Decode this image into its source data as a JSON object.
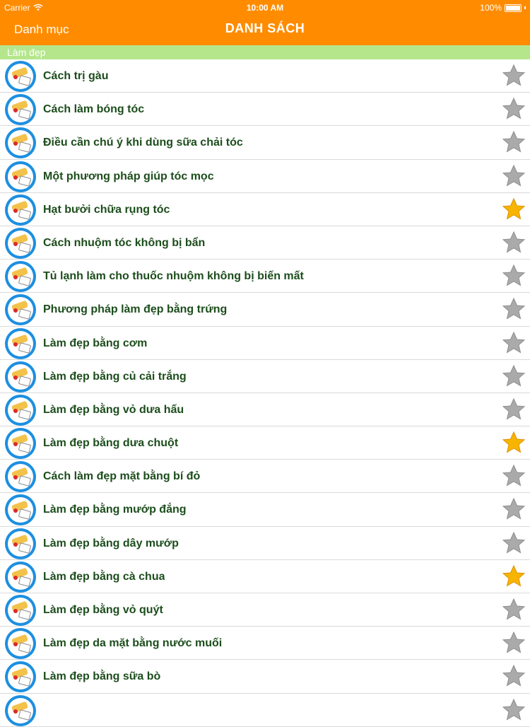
{
  "status_bar": {
    "carrier": "Carrier",
    "time": "10:00 AM",
    "battery": "100%"
  },
  "nav": {
    "back_label": "Danh mục",
    "title": "DANH SÁCH"
  },
  "section": {
    "title": "Làm đẹp"
  },
  "colors": {
    "nav_bg": "#ff8c00",
    "section_bg": "#b5e68c",
    "title_text": "#1c4d1c",
    "star_gold": "#f7b500",
    "star_gray": "#aaaaaa"
  },
  "items": [
    {
      "title": "Cách trị gàu",
      "favorite": false
    },
    {
      "title": "Cách làm bóng tóc",
      "favorite": false
    },
    {
      "title": "Điều cần chú ý khi dùng sữa chải tóc",
      "favorite": false
    },
    {
      "title": "Một phương pháp giúp tóc mọc",
      "favorite": false
    },
    {
      "title": "Hạt bưởi chữa rụng tóc",
      "favorite": true
    },
    {
      "title": "Cách nhuộm tóc không bị bẩn",
      "favorite": false
    },
    {
      "title": "Tủ lạnh làm cho thuốc nhuộm  không bị biến mất",
      "favorite": false
    },
    {
      "title": "Phương pháp làm đẹp bằng trứng",
      "favorite": false
    },
    {
      "title": "Làm đẹp bằng cơm",
      "favorite": false
    },
    {
      "title": "Làm đẹp bằng củ cải trắng",
      "favorite": false
    },
    {
      "title": "Làm đẹp bằng vỏ dưa hấu",
      "favorite": false
    },
    {
      "title": "Làm đẹp bằng dưa chuột",
      "favorite": true
    },
    {
      "title": "Cách làm đẹp mặt bằng bí đỏ",
      "favorite": false
    },
    {
      "title": "Làm đẹp bằng mướp đắng",
      "favorite": false
    },
    {
      "title": "Làm đẹp bằng dây mướp",
      "favorite": false
    },
    {
      "title": "Làm đẹp bằng cà chua",
      "favorite": true
    },
    {
      "title": "Làm đẹp bằng vỏ quýt",
      "favorite": false
    },
    {
      "title": "Làm đẹp da mặt bằng nước muối",
      "favorite": false
    },
    {
      "title": "Làm đẹp bằng sữa bò",
      "favorite": false
    },
    {
      "title": "",
      "favorite": false
    }
  ]
}
